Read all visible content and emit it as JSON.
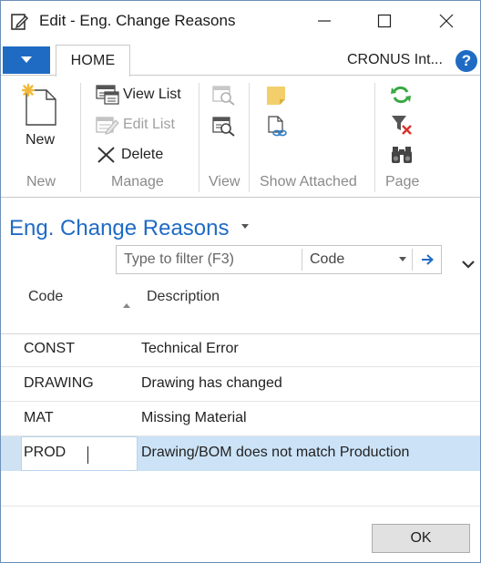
{
  "window": {
    "title": "Edit - Eng. Change Reasons"
  },
  "ribbon_tabs": {
    "home_label": "HOME",
    "company": "CRONUS Int...",
    "help_glyph": "?"
  },
  "ribbon": {
    "new_label": "New",
    "view_list_label": "View List",
    "edit_list_label": "Edit List",
    "delete_label": "Delete",
    "groups": {
      "new": "New",
      "manage": "Manage",
      "view": "View",
      "show_attached": "Show Attached",
      "page": "Page"
    }
  },
  "page": {
    "title": "Eng. Change Reasons",
    "filter_placeholder": "Type to filter (F3)",
    "filter_field": "Code"
  },
  "list": {
    "headers": {
      "code": "Code",
      "description": "Description"
    },
    "rows": [
      {
        "code": "CONST",
        "description": "Technical Error"
      },
      {
        "code": "DRAWING",
        "description": "Drawing has changed"
      },
      {
        "code": "MAT",
        "description": "Missing Material"
      },
      {
        "code": "PROD",
        "description": "Drawing/BOM does not match Production"
      }
    ],
    "selected_index": 3
  },
  "footer": {
    "ok_label": "OK"
  },
  "colors": {
    "accent": "#1f6bc4",
    "selection": "#cce3f7",
    "refresh_green": "#3aa845",
    "clear_filter_red": "#d9302b"
  }
}
